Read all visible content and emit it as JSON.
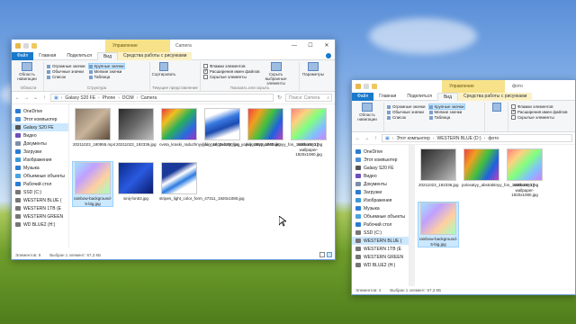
{
  "window1": {
    "context_tab_title": "Управление",
    "title": "Camera",
    "ribbon_tabs": [
      "Файл",
      "Главная",
      "Поделиться",
      "Вид",
      "Средства работы с рисунками"
    ],
    "ribbon": {
      "nav_pane_label": "Область навигации",
      "nav_group": "Области",
      "layout_items": [
        "Огромные значки",
        "Крупные значки",
        "Обычные значки",
        "Мелкие значки",
        "Список",
        "Таблица"
      ],
      "layout_selected": "Крупные значки",
      "structure_label": "Структура",
      "sort_label": "Сортировать",
      "current_view_label": "Текущее представление",
      "checks": [
        {
          "label": "Флажки элементов",
          "checked": false
        },
        {
          "label": "Расширения имен файлов",
          "checked": true
        },
        {
          "label": "Скрытые элементы",
          "checked": false
        }
      ],
      "hide_selected_label": "Скрыть выбранные элементы",
      "show_hide_label": "Показать или скрыть",
      "params_label": "Параметры"
    },
    "address": [
      "Galaxy S20 FE",
      "Phone",
      "DCIM",
      "Camera"
    ],
    "search_placeholder": "Поиск: Camera",
    "nav": [
      {
        "label": "OneDrive",
        "icon": "cloud-icon",
        "color": "#2b7cd3"
      },
      {
        "label": "Этот компьютер",
        "icon": "computer-icon",
        "color": "#4a90d9"
      },
      {
        "label": "Galaxy S20 FE",
        "icon": "phone-icon",
        "color": "#555555",
        "selected": true
      },
      {
        "label": "Видео",
        "icon": "video-icon",
        "color": "#6b4fbb"
      },
      {
        "label": "Документы",
        "icon": "document-icon",
        "color": "#7b8fa8"
      },
      {
        "label": "Загрузки",
        "icon": "download-icon",
        "color": "#2b7cd3"
      },
      {
        "label": "Изображения",
        "icon": "picture-icon",
        "color": "#3a9ad9"
      },
      {
        "label": "Музыка",
        "icon": "music-icon",
        "color": "#2b7cd3"
      },
      {
        "label": "Объемные объекты",
        "icon": "cube-icon",
        "color": "#4aa3df"
      },
      {
        "label": "Рабочий стол",
        "icon": "desktop-icon",
        "color": "#2b7cd3"
      },
      {
        "label": "SSD (C:)",
        "icon": "drive-icon",
        "color": "#777777"
      },
      {
        "label": "WESTERN BLUE (",
        "icon": "drive-icon",
        "color": "#777777"
      },
      {
        "label": "WESTERN 1TB (E",
        "icon": "drive-icon",
        "color": "#777777"
      },
      {
        "label": "WESTERN GREEN",
        "icon": "drive-icon",
        "color": "#777777"
      },
      {
        "label": "WD BLUE2 (H:)",
        "icon": "drive-icon",
        "color": "#777777"
      }
    ],
    "files": [
      {
        "name": "20211023_180955.mp4",
        "thumb": "linear-gradient(135deg,#8a7a6a,#c9b49a,#5a4a3a)"
      },
      {
        "name": "20211023_192336.jpg",
        "thumb": "linear-gradient(135deg,#2a2a2a,#6a6a6a,#bfbfbf)"
      },
      {
        "name": "cvetа_kraski_raduzhnyy_fon_1600x1200.jpg",
        "thumb": "linear-gradient(135deg,#e63a3a,#f0c020,#2ab05a,#2a6ae0,#a030c0)"
      },
      {
        "name": "linii_rval_polosy_fon_yarkiy_2560x1600.jpg",
        "thumb": "linear-gradient(160deg,#fff 20%,#3a7ae0 40%,#1a4ab0 60%,#fff 80%)"
      },
      {
        "name": "polosatyy_abstraktnyy_fon_1920x1080.jpg",
        "thumb": "linear-gradient(120deg,#f04040,#f0a020,#40c040,#2060e0,#c040c0)"
      },
      {
        "name": "rainbow_17-wallpaper-1920x1080.jpg",
        "thumb": "linear-gradient(135deg,#ff8080,#ffd080,#80ff80,#80c0ff,#d080ff)"
      },
      {
        "name": "rainbow-background-5-big.jpg",
        "thumb": "linear-gradient(135deg,#a0e0ff,#c0a0ff,#ffd0a0,#a0ffc0)",
        "selected": true
      },
      {
        "name": "sinij-fon53.jpg",
        "thumb": "linear-gradient(135deg,#0a2a8a,#2a5ae0,#0a1a6a)"
      },
      {
        "name": "stripes_light_color_form_47311_1920x1080.jpg",
        "thumb": "linear-gradient(150deg,#1a3a9a 30%,#fff 45%,#2a7ae0 60%,#fff 75%)"
      }
    ],
    "status": {
      "count": "Элементов: 9",
      "selected": "Выбран 1 элемент: 67,3 КБ"
    }
  },
  "window2": {
    "context_tab_title": "Управление",
    "title": "фото",
    "ribbon_tabs": [
      "Файл",
      "Главная",
      "Поделиться",
      "Вид",
      "Средства работы с рисунками"
    ],
    "address": [
      "Этот компьютер",
      "WESTERN BLUE (D:)",
      "фото"
    ],
    "nav": [
      {
        "label": "OneDrive",
        "icon": "cloud-icon",
        "color": "#2b7cd3"
      },
      {
        "label": "Этот компьютер",
        "icon": "computer-icon",
        "color": "#4a90d9"
      },
      {
        "label": "Galaxy S20 FE",
        "icon": "phone-icon",
        "color": "#555555"
      },
      {
        "label": "Видео",
        "icon": "video-icon",
        "color": "#6b4fbb"
      },
      {
        "label": "Документы",
        "icon": "document-icon",
        "color": "#7b8fa8"
      },
      {
        "label": "Загрузки",
        "icon": "download-icon",
        "color": "#2b7cd3"
      },
      {
        "label": "Изображения",
        "icon": "picture-icon",
        "color": "#3a9ad9"
      },
      {
        "label": "Музыка",
        "icon": "music-icon",
        "color": "#2b7cd3"
      },
      {
        "label": "Объемные объекты",
        "icon": "cube-icon",
        "color": "#4aa3df"
      },
      {
        "label": "Рабочий стол",
        "icon": "desktop-icon",
        "color": "#2b7cd3"
      },
      {
        "label": "SSD (C:)",
        "icon": "drive-icon",
        "color": "#777777"
      },
      {
        "label": "WESTERN BLUE (",
        "icon": "drive-icon",
        "color": "#777777",
        "selected": true
      },
      {
        "label": "WESTERN 1TB (E",
        "icon": "drive-icon",
        "color": "#777777"
      },
      {
        "label": "WESTERN GREEN",
        "icon": "drive-icon",
        "color": "#777777"
      },
      {
        "label": "WD BLUE2 (H:)",
        "icon": "drive-icon",
        "color": "#777777"
      }
    ],
    "files": [
      {
        "name": "20211023_192336.jpg",
        "thumb": "linear-gradient(135deg,#2a2a2a,#6a6a6a,#bfbfbf)"
      },
      {
        "name": "polosatyy_abstraktnyy_fon_1920x1080.jpg",
        "thumb": "linear-gradient(120deg,#f04040,#f0a020,#40c040,#2060e0,#c040c0)"
      },
      {
        "name": "rainbow_17-wallpaper-1920x1080.jpg",
        "thumb": "linear-gradient(135deg,#ff8080,#ffd080,#80ff80,#80c0ff,#d080ff)"
      },
      {
        "name": "rainbow-background-5-big.jpg",
        "thumb": "linear-gradient(135deg,#a0e0ff,#c0a0ff,#ffd0a0,#a0ffc0)",
        "selected": true
      }
    ],
    "status": {
      "count": "Элементов: 4",
      "selected": "Выбран 1 элемент: 67,3 КБ"
    }
  }
}
